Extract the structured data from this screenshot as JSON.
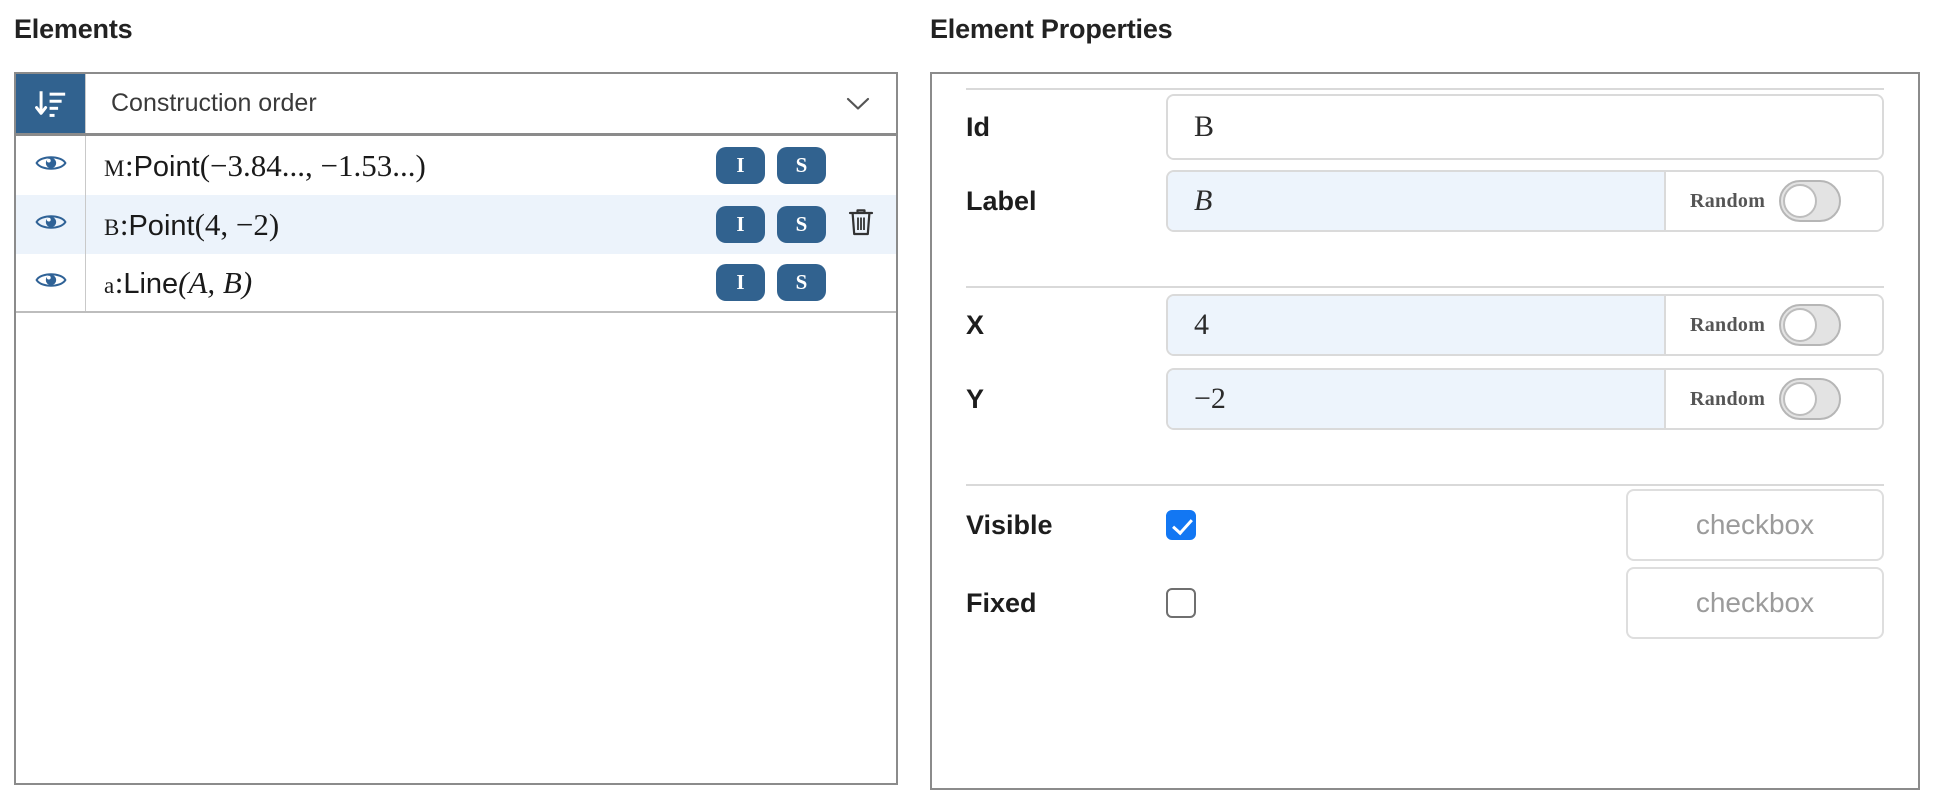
{
  "elements_panel": {
    "title": "Elements",
    "sort": {
      "icon": "sort-descending-icon",
      "selected_option": "Construction order",
      "chevron": "chevron-down-icon"
    },
    "rows": [
      {
        "visibility_icon": "eye-icon",
        "name": "M",
        "separator": ":",
        "definition": "Point(−3.84..., −1.53...)",
        "fn": "Point",
        "args": "−3.84..., −1.53...",
        "buttons": {
          "input": "I",
          "style": "S"
        },
        "selected": false,
        "has_delete": false
      },
      {
        "visibility_icon": "eye-icon",
        "name": "B",
        "separator": ":",
        "definition": "Point(4, −2)",
        "fn": "Point",
        "args": "4, −2",
        "buttons": {
          "input": "I",
          "style": "S"
        },
        "selected": true,
        "has_delete": true,
        "delete_icon": "trash-icon"
      },
      {
        "visibility_icon": "eye-icon",
        "name": "a",
        "separator": ":",
        "definition": "Line(A, B)",
        "fn": "Line",
        "args": "A, B",
        "buttons": {
          "input": "I",
          "style": "S"
        },
        "selected": false,
        "has_delete": false
      }
    ]
  },
  "properties_panel": {
    "title": "Element Properties",
    "fields": [
      {
        "label": "Id",
        "value": "B",
        "tinted": false,
        "italic": false,
        "has_random": false
      },
      {
        "label": "Label",
        "value": "B",
        "tinted": true,
        "italic": true,
        "has_random": true,
        "random_label": "Random",
        "random_on": false
      },
      {
        "label": "X",
        "value": "4",
        "tinted": true,
        "italic": false,
        "has_random": true,
        "random_label": "Random",
        "random_on": false
      },
      {
        "label": "Y",
        "value": "−2",
        "tinted": true,
        "italic": false,
        "has_random": true,
        "random_label": "Random",
        "random_on": false
      }
    ],
    "checkboxes": [
      {
        "label": "Visible",
        "checked": true,
        "ghost_text": "checkbox"
      },
      {
        "label": "Fixed",
        "checked": false,
        "ghost_text": "checkbox"
      }
    ]
  },
  "colors": {
    "accent_blue": "#31628f",
    "checkbox_blue": "#1277f3",
    "selected_row": "#ecf3fb",
    "tinted_field": "#edf4fc",
    "border_grey": "#8b8b8b"
  }
}
